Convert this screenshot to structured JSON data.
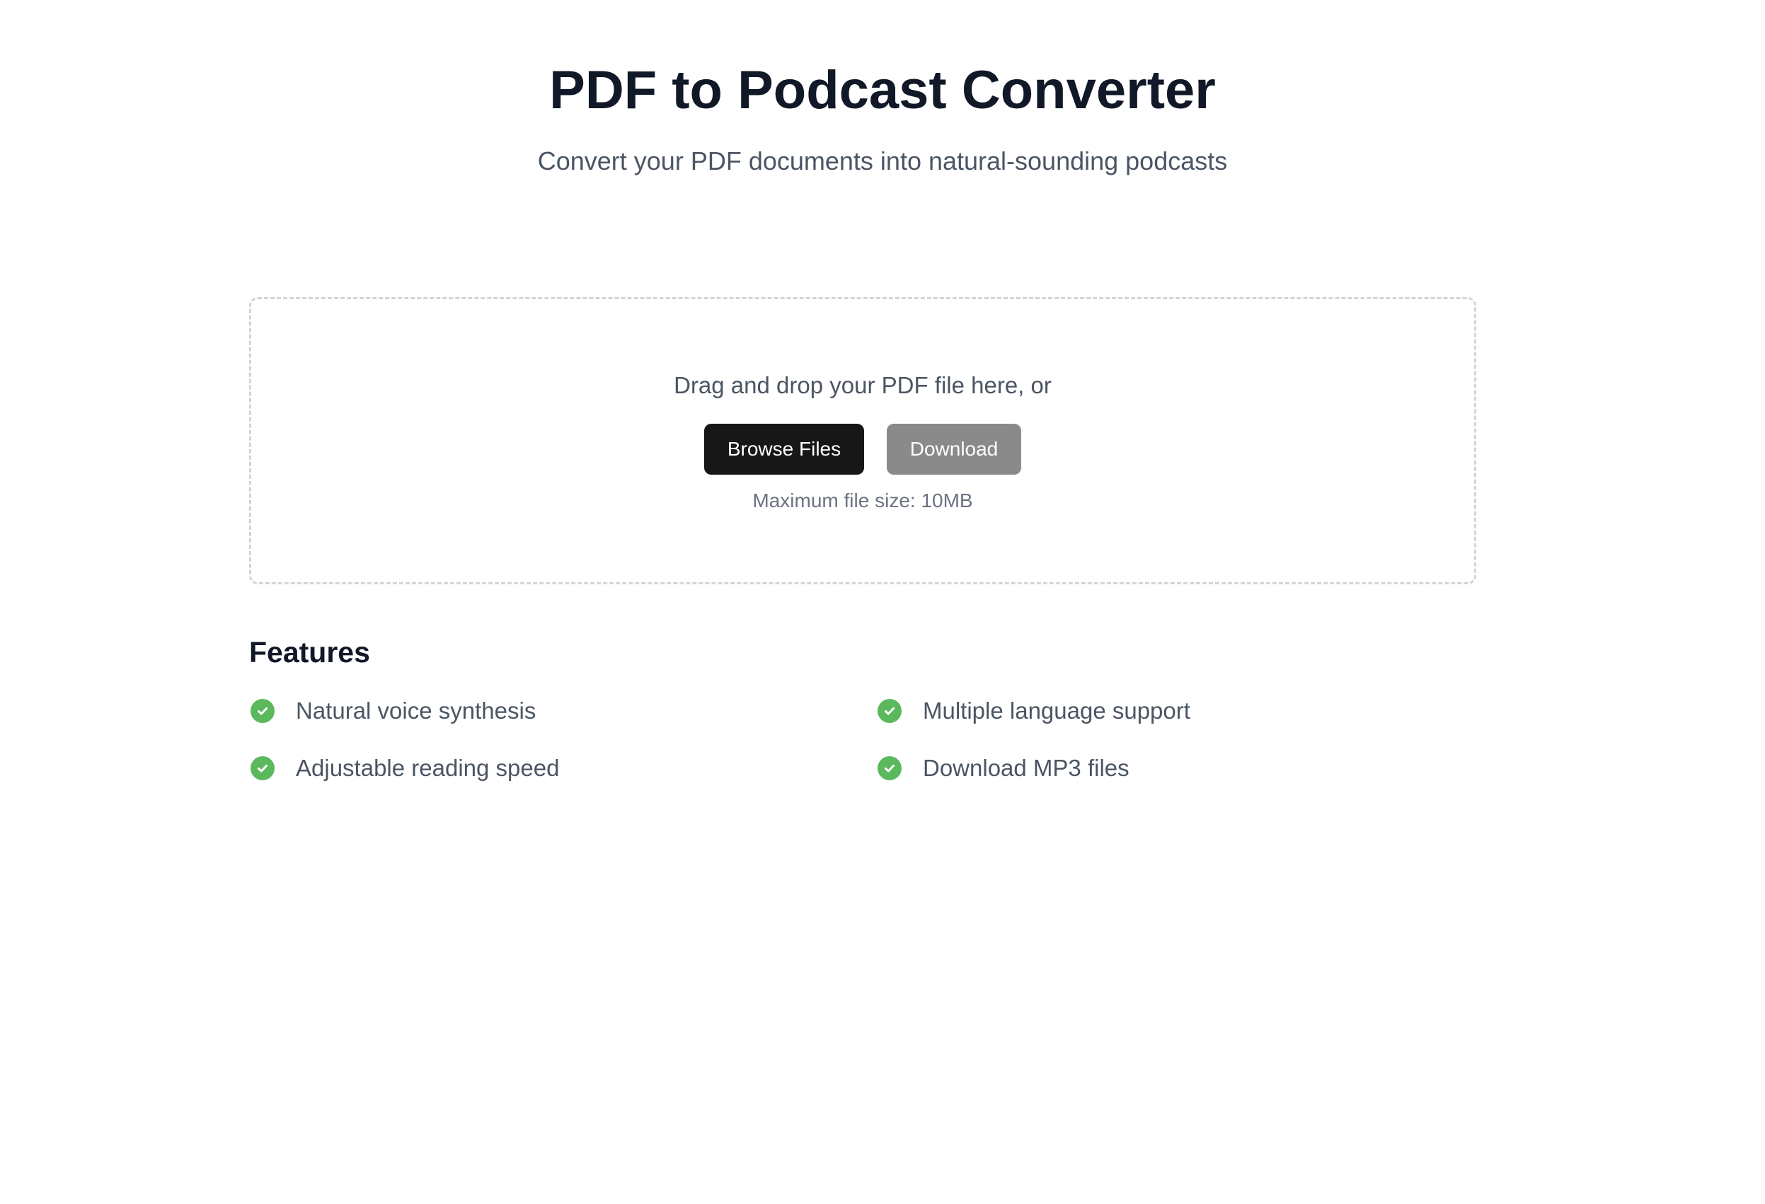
{
  "header": {
    "title": "PDF to Podcast Converter",
    "subtitle": "Convert your PDF documents into natural-sounding podcasts"
  },
  "upload": {
    "prompt": "Drag and drop your PDF file here, or",
    "browse_label": "Browse Files",
    "download_label": "Download",
    "max_size_text": "Maximum file size: 10MB"
  },
  "features": {
    "title": "Features",
    "items": [
      {
        "label": "Natural voice synthesis",
        "icon": "check-circle-icon"
      },
      {
        "label": "Multiple language support",
        "icon": "check-circle-icon"
      },
      {
        "label": "Adjustable reading speed",
        "icon": "check-circle-icon"
      },
      {
        "label": "Download MP3 files",
        "icon": "check-circle-icon"
      }
    ]
  },
  "colors": {
    "primary_button": "#171717",
    "secondary_button": "#8a8a8a",
    "check_green": "#5cb85c",
    "title_text": "#111827",
    "body_text": "#4b5563"
  }
}
